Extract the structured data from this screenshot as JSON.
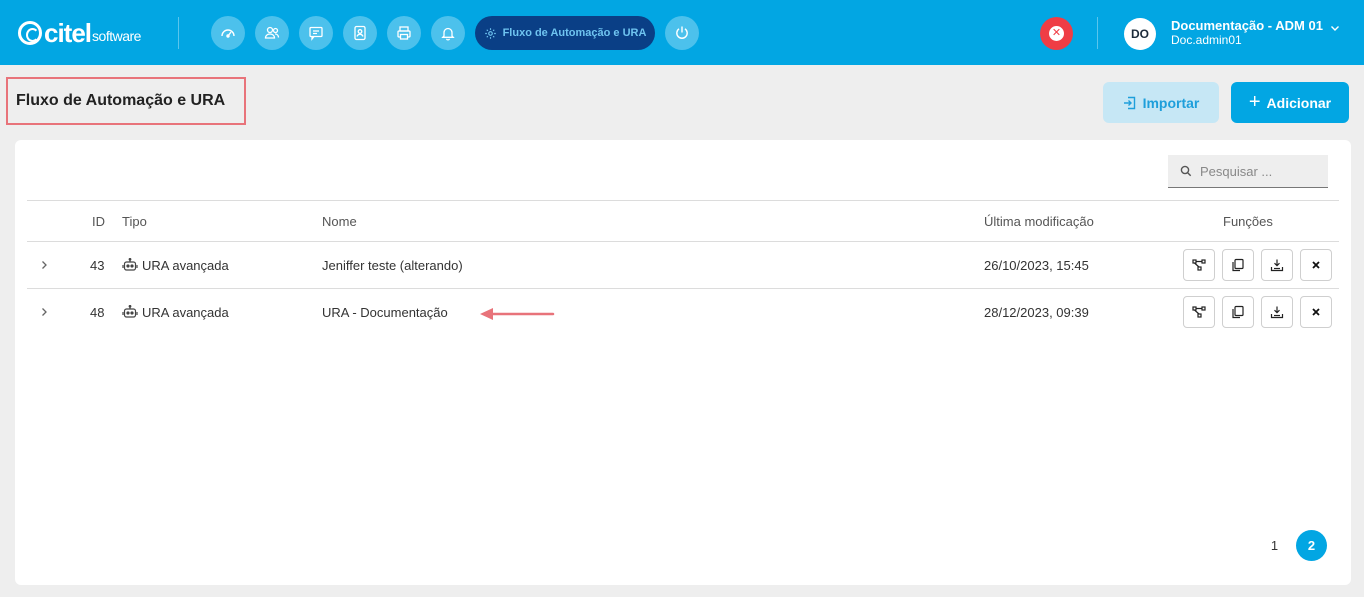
{
  "brand": {
    "name": "citel",
    "sub": "software"
  },
  "nav": {
    "icons": [
      "dashboard-icon",
      "users-icon",
      "chat-icon",
      "contacts-icon",
      "printer-icon",
      "bell-icon"
    ],
    "active_label": "Fluxo de Automação e URA",
    "power_icon": "power-icon"
  },
  "user": {
    "initials": "DO",
    "name": "Documentação - ADM 01",
    "login": "Doc.admin01"
  },
  "page": {
    "title": "Fluxo de Automação e URA"
  },
  "actions": {
    "import_label": "Importar",
    "add_label": "Adicionar"
  },
  "search": {
    "placeholder": "Pesquisar ..."
  },
  "table": {
    "headers": {
      "id": "ID",
      "type": "Tipo",
      "name": "Nome",
      "modified": "Última modificação",
      "functions": "Funções"
    },
    "rows": [
      {
        "id": "43",
        "type": "URA avançada",
        "name": "Jeniffer teste (alterando)",
        "modified": "26/10/2023, 15:45"
      },
      {
        "id": "48",
        "type": "URA avançada",
        "name": "URA - Documentação",
        "modified": "28/12/2023, 09:39"
      }
    ]
  },
  "pagination": {
    "pages": [
      "1",
      "2"
    ],
    "current": "2"
  },
  "colors": {
    "primary": "#02a6e3",
    "nav_active": "#0a3f86",
    "danger": "#ef3d45",
    "highlight": "#e8737a"
  }
}
